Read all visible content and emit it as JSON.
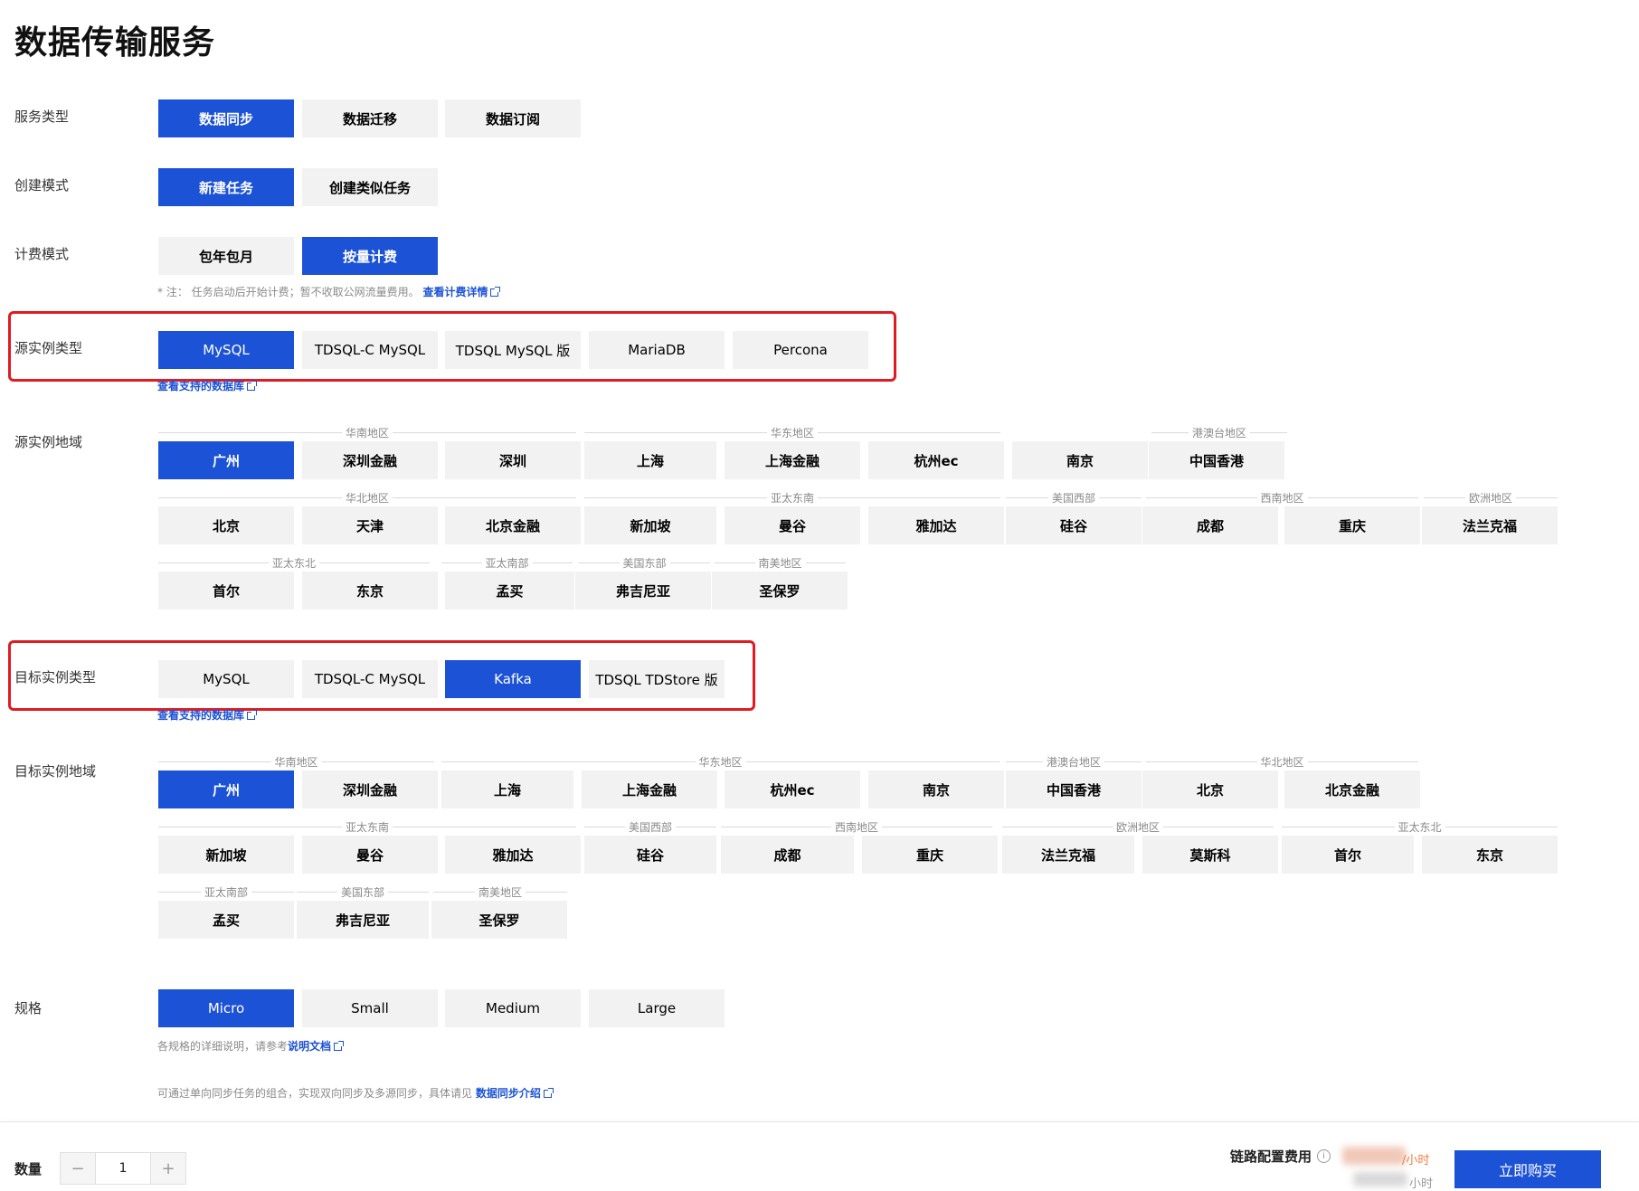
{
  "page": {
    "title": "数据传输服务"
  },
  "service_type": {
    "label": "服务类型",
    "options": [
      "数据同步",
      "数据迁移",
      "数据订阅"
    ]
  },
  "create_mode": {
    "label": "创建模式",
    "options": [
      "新建任务",
      "创建类似任务"
    ]
  },
  "billing_mode": {
    "label": "计费模式",
    "options": [
      "包年包月",
      "按量计费"
    ],
    "note_prefix": "* 注： 任务启动后开始计费；暂不收取公网流量费用。",
    "note_link": "查看计费详情"
  },
  "source_type": {
    "label": "源实例类型",
    "options": [
      "MySQL",
      "TDSQL-C MySQL",
      "TDSQL MySQL 版",
      "MariaDB",
      "Percona"
    ],
    "link": "查看支持的数据库"
  },
  "source_region": {
    "label": "源实例地域",
    "groups": [
      "华南地区",
      "华东地区",
      "港澳台地区",
      "华北地区",
      "亚太东南",
      "美国西部",
      "西南地区",
      "欧洲地区",
      "亚太东北",
      "亚太南部",
      "美国东部",
      "南美地区"
    ],
    "options": [
      "广州",
      "深圳金融",
      "深圳",
      "上海",
      "上海金融",
      "杭州ec",
      "南京",
      "中国香港",
      "北京",
      "天津",
      "北京金融",
      "新加坡",
      "曼谷",
      "雅加达",
      "硅谷",
      "成都",
      "重庆",
      "法兰克福",
      "首尔",
      "东京",
      "孟买",
      "弗吉尼亚",
      "圣保罗"
    ]
  },
  "target_type": {
    "label": "目标实例类型",
    "options": [
      "MySQL",
      "TDSQL-C MySQL",
      "Kafka",
      "TDSQL TDStore 版"
    ],
    "link": "查看支持的数据库"
  },
  "target_region": {
    "label": "目标实例地域",
    "groups": [
      "华南地区",
      "华东地区",
      "港澳台地区",
      "华北地区",
      "亚太东南",
      "美国西部",
      "西南地区",
      "欧洲地区",
      "亚太东北",
      "亚太南部",
      "美国东部",
      "南美地区"
    ],
    "options": [
      "广州",
      "深圳金融",
      "上海",
      "上海金融",
      "杭州ec",
      "南京",
      "中国香港",
      "北京",
      "北京金融",
      "新加坡",
      "曼谷",
      "雅加达",
      "硅谷",
      "成都",
      "重庆",
      "法兰克福",
      "莫斯科",
      "首尔",
      "东京",
      "孟买",
      "弗吉尼亚",
      "圣保罗"
    ]
  },
  "spec": {
    "label": "规格",
    "options": [
      "Micro",
      "Small",
      "Medium",
      "Large"
    ],
    "note_prefix": "各规格的详细说明，请参考",
    "note_link": "说明文档"
  },
  "footer_note": {
    "prefix": "可通过单向同步任务的组合，实现双向同步及多源同步，具体请见 ",
    "link": "数据同步介绍"
  },
  "bottom": {
    "qty_label": "数量",
    "qty_minus": "−",
    "qty_value": "1",
    "qty_plus": "+",
    "fee_label": "链路配置费用",
    "info_glyph": "i",
    "price_unit": "/小时",
    "price_unit_2": "小时",
    "buy_label": "立即购买"
  },
  "colors": {
    "accent": "#1c52d5",
    "highlight_box": "#e01b22",
    "price": "#f07b3f"
  }
}
